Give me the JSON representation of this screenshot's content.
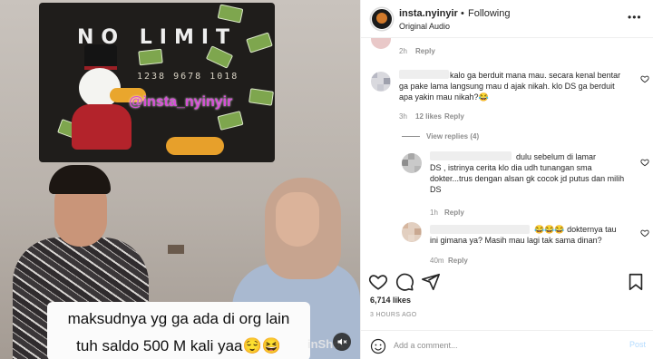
{
  "video": {
    "poster_title": "NO LIMIT",
    "poster_card_number": "1238 9678 1018",
    "watermark": "@insta_nyinyir",
    "caption_line1": "maksudnya yg ga ada di org lain",
    "caption_line2": "tuh saldo 500 M kali yaa😌😆",
    "inshot_brand": "inShot",
    "mute_icon": "speaker-muted-icon"
  },
  "header": {
    "username": "insta.nyinyir",
    "separator": "•",
    "follow_status": "Following",
    "audio": "Original Audio",
    "more_icon": "more-horizontal-icon"
  },
  "comments": {
    "top_partial": {
      "time": "2h",
      "reply": "Reply"
    },
    "comment1": {
      "lines": [
        "kalo ga berduit mana mau. secara kenal bentar",
        "ga pake lama langsung mau d ajak nikah. klo DS ga berduit",
        "apa yakin mau nikah?😂"
      ],
      "time": "3h",
      "likes": "12 likes",
      "reply": "Reply",
      "view_replies": "View replies (4)"
    },
    "reply1": {
      "lines": [
        "dulu sebelum di lamar",
        "DS , istrinya cerita klo dia udh tunangan sma",
        "dokter...trus dengan alsan gk cocok jd putus dan milih",
        "DS"
      ],
      "time": "1h",
      "reply": "Reply"
    },
    "reply2": {
      "lines": [
        "😂😂😂 dokternya tau",
        "ini gimana ya? Masih mau lagi tak sama dinan?"
      ],
      "time": "40m",
      "reply": "Reply"
    }
  },
  "actions": {
    "like_icon": "heart-icon",
    "comment_icon": "comment-icon",
    "share_icon": "paper-plane-icon",
    "save_icon": "bookmark-icon",
    "likes": "6,714 likes",
    "posted": "3 HOURS AGO"
  },
  "add_comment": {
    "emoji_icon": "smiley-icon",
    "placeholder": "Add a comment...",
    "post_label": "Post",
    "post_color": "#b3dbff"
  },
  "colors": {
    "text": "#262626",
    "muted": "#8e8e8e",
    "divider": "#efefef",
    "link_blue": "#0095f6"
  }
}
